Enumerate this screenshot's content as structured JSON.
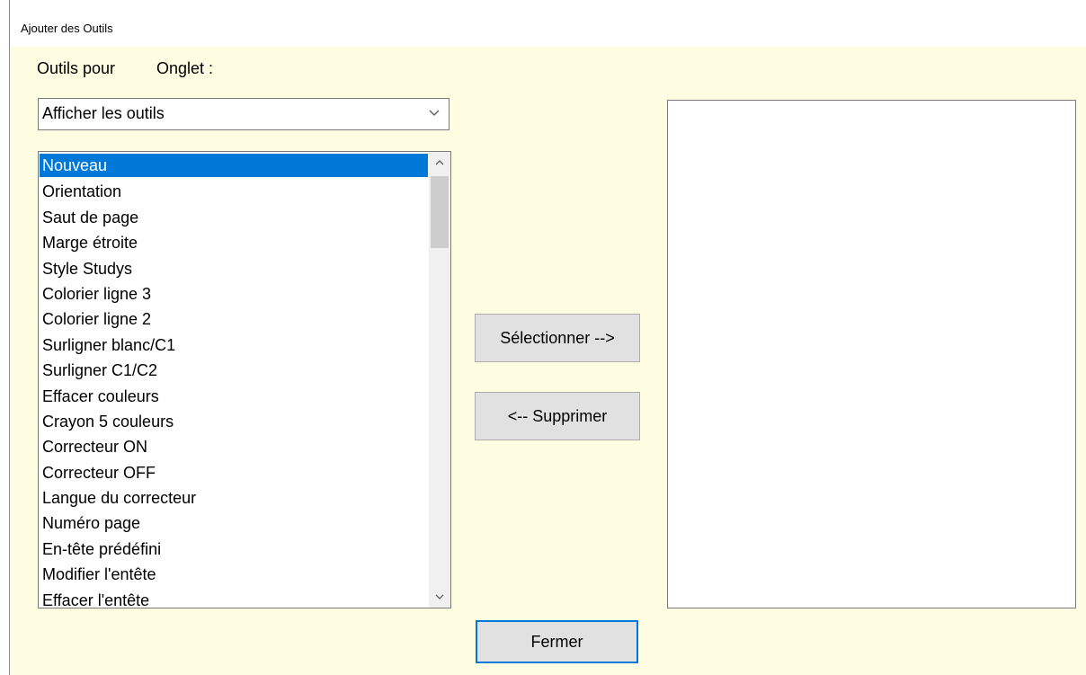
{
  "window": {
    "title": "Ajouter des Outils"
  },
  "labels": {
    "outils_pour": "Outils pour",
    "onglet": "Onglet :"
  },
  "combo": {
    "value": "Afficher les outils"
  },
  "list": {
    "items": [
      "Nouveau",
      "Orientation",
      "Saut de page",
      "Marge étroite",
      "Style Studys",
      "Colorier ligne 3",
      "Colorier ligne 2",
      "Surligner blanc/C1",
      "Surligner C1/C2",
      "Effacer couleurs",
      "Crayon 5 couleurs",
      "Correcteur ON",
      "Correcteur OFF",
      "Langue du correcteur",
      "Numéro page",
      "En-tête prédéfini",
      "Modifier l'entête",
      "Effacer l'entête"
    ],
    "selected_index": 0
  },
  "buttons": {
    "select": "Sélectionner -->",
    "remove": "<-- Supprimer",
    "close": "Fermer"
  },
  "colors": {
    "client_bg": "#fffde1",
    "selection": "#0078d7",
    "button_bg": "#e1e1e1",
    "focus_border": "#0078d7"
  },
  "icons": {
    "combo_arrow": "chevron-down-icon",
    "scroll_up": "chevron-up-icon",
    "scroll_down": "chevron-down-icon"
  }
}
